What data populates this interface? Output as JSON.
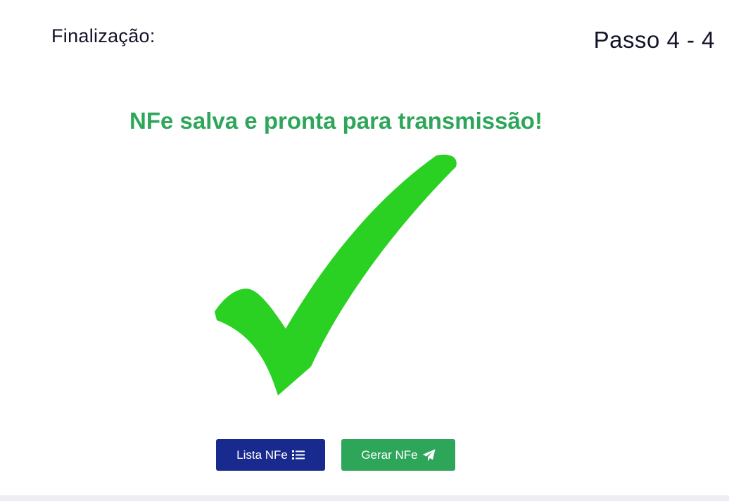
{
  "header": {
    "step_label": "Finalização:",
    "step_counter": "Passo 4 - 4"
  },
  "main": {
    "success_message": "NFe salva e pronta para transmissão!",
    "check_icon": "checkmark-icon",
    "check_color": "#2ad123"
  },
  "actions": {
    "list_button": {
      "label": "Lista NFe",
      "icon": "list-icon",
      "color": "#192a8f"
    },
    "generate_button": {
      "label": "Gerar NFe",
      "icon": "paper-plane-icon",
      "color": "#2ea65a"
    }
  }
}
